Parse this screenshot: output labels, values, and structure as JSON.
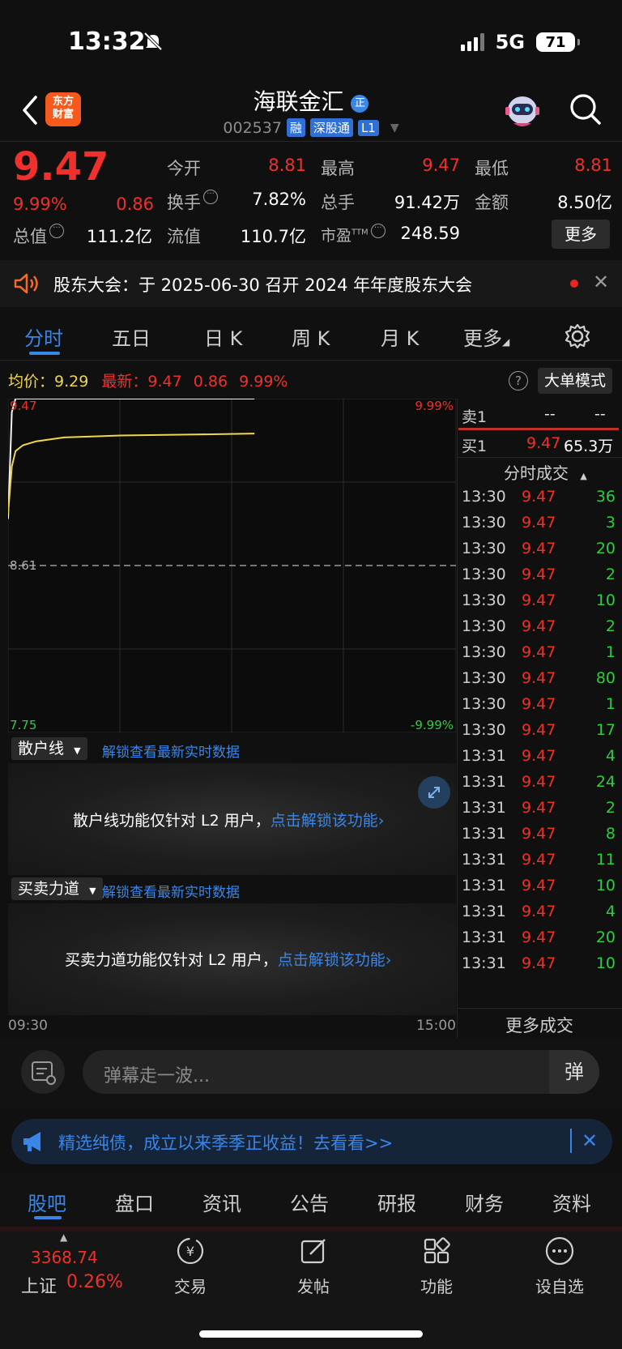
{
  "status_bar": {
    "time": "13:32",
    "network": "5G",
    "battery": "71"
  },
  "header": {
    "logo_line1": "东方",
    "logo_line2": "财富",
    "stock_name": "海联金汇",
    "name_badge": "正",
    "stock_code": "002537",
    "tags": [
      "融",
      "深股通",
      "L1"
    ]
  },
  "quote": {
    "price": "9.47",
    "change_pct": "9.99%",
    "change": "0.86",
    "open_label": "今开",
    "open": "8.81",
    "high_label": "最高",
    "high": "9.47",
    "low_label": "最低",
    "low": "8.81",
    "turnover_label": "换手",
    "turnover": "7.82%",
    "volume_label": "总手",
    "volume": "91.42万",
    "amount_label": "金额",
    "amount": "8.50亿",
    "mktcap_label": "总值",
    "mktcap": "111.2亿",
    "float_label": "流值",
    "float_cap": "110.7亿",
    "pe_label": "市盈",
    "pe_sup": "TTM",
    "pe": "248.59",
    "more_label": "更多"
  },
  "notice": {
    "text": "股东大会：于 2025-06-30 召开 2024 年年度股东大会"
  },
  "period_tabs": [
    "分时",
    "五日",
    "日 K",
    "周 K",
    "月 K",
    "更多"
  ],
  "chart_info": {
    "avg_label": "均价：",
    "avg": "9.29",
    "latest_label": "最新：",
    "latest": "9.47",
    "change": "0.86",
    "change_pct": "9.99%",
    "big_order_label": "大单模式"
  },
  "chart_data": {
    "type": "line",
    "y_top_label": "9.47",
    "y_mid_label": "8.61",
    "y_bottom_label": "7.75",
    "pct_top_label": "9.99%",
    "pct_bottom_label": "-9.99%",
    "x_start_label": "09:30",
    "x_end_label": "15:00",
    "ylim": [
      7.75,
      9.47
    ],
    "reference_price": 8.61,
    "series": [
      {
        "color": "#f2f2f2",
        "points": [
          [
            0,
            8.85
          ],
          [
            2,
            9.4
          ],
          [
            4,
            9.47
          ],
          [
            10,
            9.47
          ],
          [
            60,
            9.47
          ],
          [
            150,
            9.47
          ],
          [
            240,
            9.47
          ]
        ]
      },
      {
        "color": "#f2d64b",
        "points": [
          [
            0,
            8.88
          ],
          [
            2,
            9.12
          ],
          [
            4,
            9.2
          ],
          [
            8,
            9.23
          ],
          [
            15,
            9.25
          ],
          [
            30,
            9.27
          ],
          [
            60,
            9.28
          ],
          [
            100,
            9.285
          ],
          [
            150,
            9.29
          ],
          [
            240,
            9.29
          ]
        ]
      }
    ]
  },
  "sub_panels": [
    {
      "select": "散户线",
      "link": "解锁查看最新实时数据",
      "msg": "散户线功能仅针对 L2 用户，",
      "cta": "点击解锁该功能"
    },
    {
      "select": "买卖力道",
      "link": "解锁查看最新实时数据",
      "msg": "买卖力道功能仅针对 L2 用户，",
      "cta": "点击解锁该功能"
    }
  ],
  "order_book": {
    "sell1_label": "卖1",
    "sell1_price": "--",
    "sell1_vol": "--",
    "buy1_label": "买1",
    "buy1_price": "9.47",
    "buy1_vol": "65.3万"
  },
  "trades_header": "分时成交",
  "trades": [
    {
      "time": "13:30",
      "price": "9.47",
      "vol": "36"
    },
    {
      "time": "13:30",
      "price": "9.47",
      "vol": "3"
    },
    {
      "time": "13:30",
      "price": "9.47",
      "vol": "20"
    },
    {
      "time": "13:30",
      "price": "9.47",
      "vol": "2"
    },
    {
      "time": "13:30",
      "price": "9.47",
      "vol": "10"
    },
    {
      "time": "13:30",
      "price": "9.47",
      "vol": "2"
    },
    {
      "time": "13:30",
      "price": "9.47",
      "vol": "1"
    },
    {
      "time": "13:30",
      "price": "9.47",
      "vol": "80"
    },
    {
      "time": "13:30",
      "price": "9.47",
      "vol": "1"
    },
    {
      "time": "13:30",
      "price": "9.47",
      "vol": "17"
    },
    {
      "time": "13:31",
      "price": "9.47",
      "vol": "4"
    },
    {
      "time": "13:31",
      "price": "9.47",
      "vol": "24"
    },
    {
      "time": "13:31",
      "price": "9.47",
      "vol": "2"
    },
    {
      "time": "13:31",
      "price": "9.47",
      "vol": "8"
    },
    {
      "time": "13:31",
      "price": "9.47",
      "vol": "11"
    },
    {
      "time": "13:31",
      "price": "9.47",
      "vol": "10"
    },
    {
      "time": "13:31",
      "price": "9.47",
      "vol": "4"
    },
    {
      "time": "13:31",
      "price": "9.47",
      "vol": "20"
    },
    {
      "time": "13:31",
      "price": "9.47",
      "vol": "10"
    }
  ],
  "more_trades_label": "更多成交",
  "comment": {
    "placeholder": "弹幕走一波...",
    "danmu_label": "弹"
  },
  "ad": {
    "text": "精选纯债，成立以来季季正收益！去看看>>"
  },
  "bottom_tabs": [
    "股吧",
    "盘口",
    "资讯",
    "公告",
    "研报",
    "财务",
    "资料"
  ],
  "index": {
    "value": "3368.74",
    "name": "上证",
    "change_pct": "0.26%"
  },
  "nav": {
    "trade": "交易",
    "post": "发帖",
    "func": "功能",
    "watch": "设自选"
  },
  "colors": {
    "up": "#f0302c",
    "down": "#2ecc40",
    "accent": "#3a86e8",
    "avg_line": "#f2d64b"
  }
}
